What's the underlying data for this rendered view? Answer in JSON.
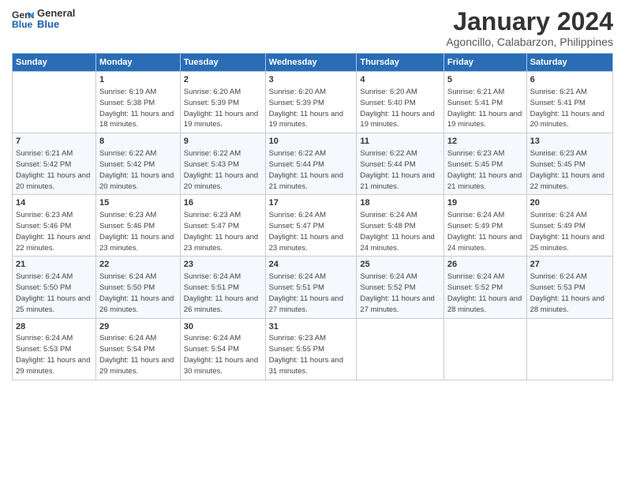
{
  "logo": {
    "line1": "General",
    "line2": "Blue"
  },
  "title": "January 2024",
  "location": "Agoncillo, Calabarzon, Philippines",
  "days_header": [
    "Sunday",
    "Monday",
    "Tuesday",
    "Wednesday",
    "Thursday",
    "Friday",
    "Saturday"
  ],
  "weeks": [
    [
      {
        "day": "",
        "sunrise": "",
        "sunset": "",
        "daylight": ""
      },
      {
        "day": "1",
        "sunrise": "Sunrise: 6:19 AM",
        "sunset": "Sunset: 5:38 PM",
        "daylight": "Daylight: 11 hours and 18 minutes."
      },
      {
        "day": "2",
        "sunrise": "Sunrise: 6:20 AM",
        "sunset": "Sunset: 5:39 PM",
        "daylight": "Daylight: 11 hours and 19 minutes."
      },
      {
        "day": "3",
        "sunrise": "Sunrise: 6:20 AM",
        "sunset": "Sunset: 5:39 PM",
        "daylight": "Daylight: 11 hours and 19 minutes."
      },
      {
        "day": "4",
        "sunrise": "Sunrise: 6:20 AM",
        "sunset": "Sunset: 5:40 PM",
        "daylight": "Daylight: 11 hours and 19 minutes."
      },
      {
        "day": "5",
        "sunrise": "Sunrise: 6:21 AM",
        "sunset": "Sunset: 5:41 PM",
        "daylight": "Daylight: 11 hours and 19 minutes."
      },
      {
        "day": "6",
        "sunrise": "Sunrise: 6:21 AM",
        "sunset": "Sunset: 5:41 PM",
        "daylight": "Daylight: 11 hours and 20 minutes."
      }
    ],
    [
      {
        "day": "7",
        "sunrise": "Sunrise: 6:21 AM",
        "sunset": "Sunset: 5:42 PM",
        "daylight": "Daylight: 11 hours and 20 minutes."
      },
      {
        "day": "8",
        "sunrise": "Sunrise: 6:22 AM",
        "sunset": "Sunset: 5:42 PM",
        "daylight": "Daylight: 11 hours and 20 minutes."
      },
      {
        "day": "9",
        "sunrise": "Sunrise: 6:22 AM",
        "sunset": "Sunset: 5:43 PM",
        "daylight": "Daylight: 11 hours and 20 minutes."
      },
      {
        "day": "10",
        "sunrise": "Sunrise: 6:22 AM",
        "sunset": "Sunset: 5:44 PM",
        "daylight": "Daylight: 11 hours and 21 minutes."
      },
      {
        "day": "11",
        "sunrise": "Sunrise: 6:22 AM",
        "sunset": "Sunset: 5:44 PM",
        "daylight": "Daylight: 11 hours and 21 minutes."
      },
      {
        "day": "12",
        "sunrise": "Sunrise: 6:23 AM",
        "sunset": "Sunset: 5:45 PM",
        "daylight": "Daylight: 11 hours and 21 minutes."
      },
      {
        "day": "13",
        "sunrise": "Sunrise: 6:23 AM",
        "sunset": "Sunset: 5:45 PM",
        "daylight": "Daylight: 11 hours and 22 minutes."
      }
    ],
    [
      {
        "day": "14",
        "sunrise": "Sunrise: 6:23 AM",
        "sunset": "Sunset: 5:46 PM",
        "daylight": "Daylight: 11 hours and 22 minutes."
      },
      {
        "day": "15",
        "sunrise": "Sunrise: 6:23 AM",
        "sunset": "Sunset: 5:46 PM",
        "daylight": "Daylight: 11 hours and 23 minutes."
      },
      {
        "day": "16",
        "sunrise": "Sunrise: 6:23 AM",
        "sunset": "Sunset: 5:47 PM",
        "daylight": "Daylight: 11 hours and 23 minutes."
      },
      {
        "day": "17",
        "sunrise": "Sunrise: 6:24 AM",
        "sunset": "Sunset: 5:47 PM",
        "daylight": "Daylight: 11 hours and 23 minutes."
      },
      {
        "day": "18",
        "sunrise": "Sunrise: 6:24 AM",
        "sunset": "Sunset: 5:48 PM",
        "daylight": "Daylight: 11 hours and 24 minutes."
      },
      {
        "day": "19",
        "sunrise": "Sunrise: 6:24 AM",
        "sunset": "Sunset: 5:49 PM",
        "daylight": "Daylight: 11 hours and 24 minutes."
      },
      {
        "day": "20",
        "sunrise": "Sunrise: 6:24 AM",
        "sunset": "Sunset: 5:49 PM",
        "daylight": "Daylight: 11 hours and 25 minutes."
      }
    ],
    [
      {
        "day": "21",
        "sunrise": "Sunrise: 6:24 AM",
        "sunset": "Sunset: 5:50 PM",
        "daylight": "Daylight: 11 hours and 25 minutes."
      },
      {
        "day": "22",
        "sunrise": "Sunrise: 6:24 AM",
        "sunset": "Sunset: 5:50 PM",
        "daylight": "Daylight: 11 hours and 26 minutes."
      },
      {
        "day": "23",
        "sunrise": "Sunrise: 6:24 AM",
        "sunset": "Sunset: 5:51 PM",
        "daylight": "Daylight: 11 hours and 26 minutes."
      },
      {
        "day": "24",
        "sunrise": "Sunrise: 6:24 AM",
        "sunset": "Sunset: 5:51 PM",
        "daylight": "Daylight: 11 hours and 27 minutes."
      },
      {
        "day": "25",
        "sunrise": "Sunrise: 6:24 AM",
        "sunset": "Sunset: 5:52 PM",
        "daylight": "Daylight: 11 hours and 27 minutes."
      },
      {
        "day": "26",
        "sunrise": "Sunrise: 6:24 AM",
        "sunset": "Sunset: 5:52 PM",
        "daylight": "Daylight: 11 hours and 28 minutes."
      },
      {
        "day": "27",
        "sunrise": "Sunrise: 6:24 AM",
        "sunset": "Sunset: 5:53 PM",
        "daylight": "Daylight: 11 hours and 28 minutes."
      }
    ],
    [
      {
        "day": "28",
        "sunrise": "Sunrise: 6:24 AM",
        "sunset": "Sunset: 5:53 PM",
        "daylight": "Daylight: 11 hours and 29 minutes."
      },
      {
        "day": "29",
        "sunrise": "Sunrise: 6:24 AM",
        "sunset": "Sunset: 5:54 PM",
        "daylight": "Daylight: 11 hours and 29 minutes."
      },
      {
        "day": "30",
        "sunrise": "Sunrise: 6:24 AM",
        "sunset": "Sunset: 5:54 PM",
        "daylight": "Daylight: 11 hours and 30 minutes."
      },
      {
        "day": "31",
        "sunrise": "Sunrise: 6:23 AM",
        "sunset": "Sunset: 5:55 PM",
        "daylight": "Daylight: 11 hours and 31 minutes."
      },
      {
        "day": "",
        "sunrise": "",
        "sunset": "",
        "daylight": ""
      },
      {
        "day": "",
        "sunrise": "",
        "sunset": "",
        "daylight": ""
      },
      {
        "day": "",
        "sunrise": "",
        "sunset": "",
        "daylight": ""
      }
    ]
  ]
}
